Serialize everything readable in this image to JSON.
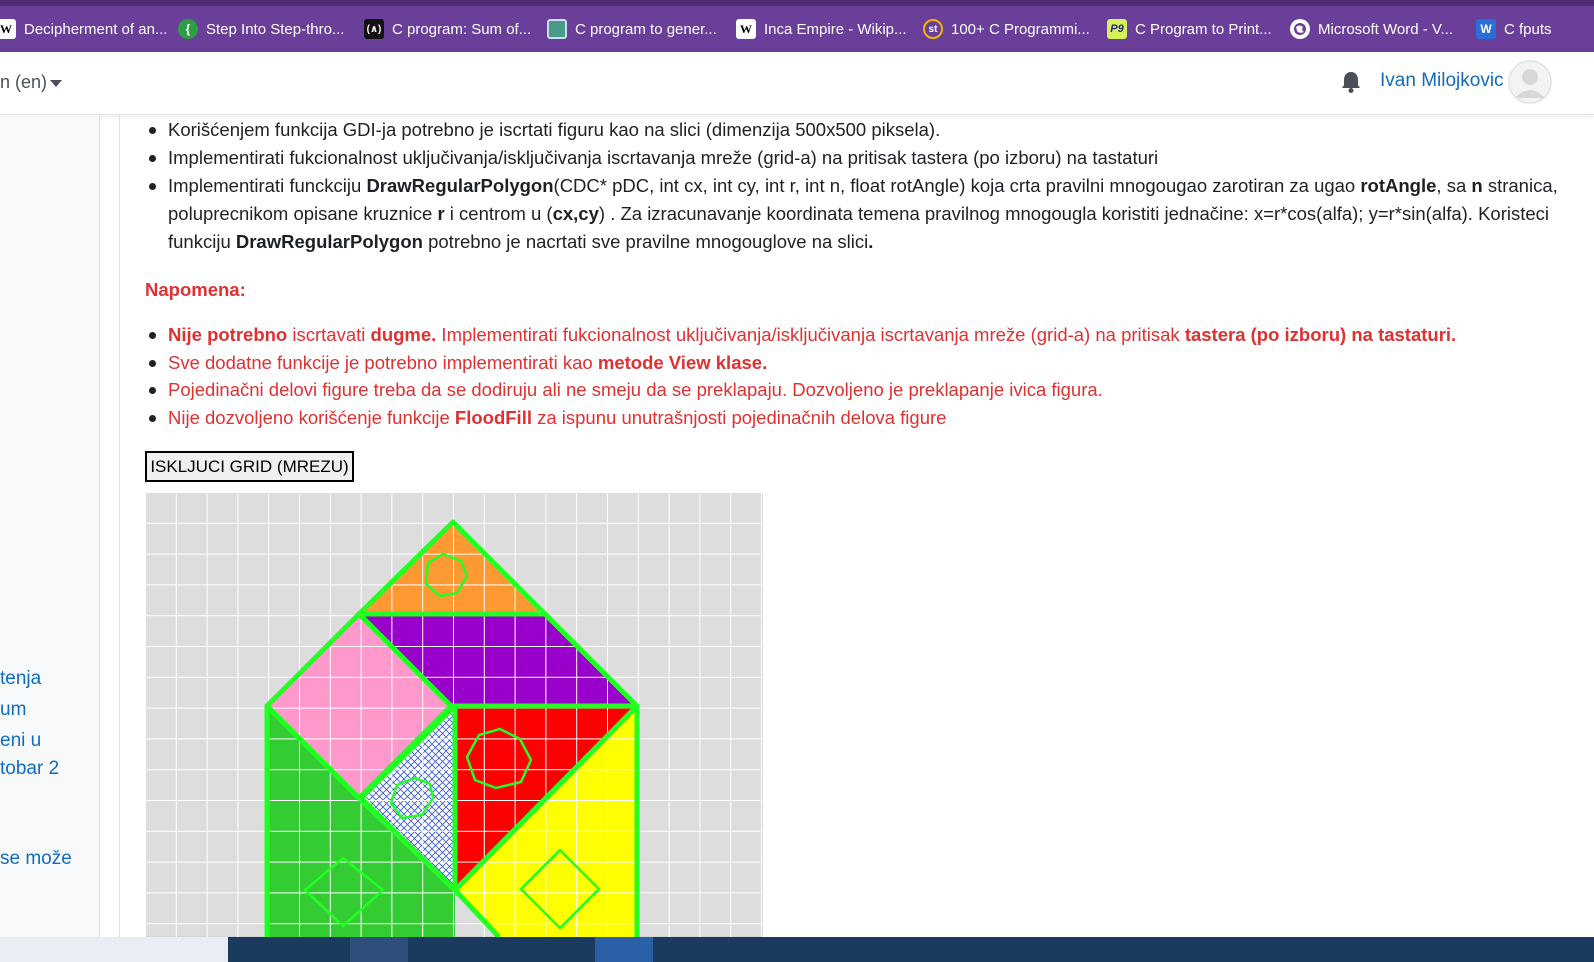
{
  "bookmarks": [
    {
      "label": "Decipherment of an...",
      "icon": "w-icon"
    },
    {
      "label": "Step Into Step-thro...",
      "icon": "green-brace-icon"
    },
    {
      "label": "C program: Sum of...",
      "icon": "code-icon"
    },
    {
      "label": "C program to gener...",
      "icon": "page-icon"
    },
    {
      "label": "Inca Empire - Wikip...",
      "icon": "wikipedia-icon"
    },
    {
      "label": "100+ C Programmi...",
      "icon": "st-icon"
    },
    {
      "label": "C Program to Print...",
      "icon": "p9-icon"
    },
    {
      "label": "Microsoft Word - V...",
      "icon": "globe-icon"
    },
    {
      "label": "C fputs",
      "icon": "w-blue-icon"
    }
  ],
  "header": {
    "language": "n (en)",
    "username": "Ivan Milojkovic"
  },
  "drawer": {
    "links": [
      "tenja",
      "um",
      "eni u",
      "tobar 2",
      "se može"
    ]
  },
  "tasks": {
    "item1": "Korišćenjem funkcija GDI-ja potrebno je iscrtati figuru kao na slici (dimenzija 500x500 piksela).",
    "item2": "Implementirati fukcionalnost uključivanja/isključivanja iscrtavanja mreže (grid-a) na pritisak tastera (po izboru) na tastaturi",
    "item3": {
      "p1": "Implementirati funckciju ",
      "b1": "DrawRegularPolygon",
      "p2": "(CDC* pDC, int cx, int cy, int r, int n, float rotAngle) koja crta pravilni mnogougao zarotiran za ugao ",
      "b2": "rotAngle",
      "p3": ", sa ",
      "b3": "n",
      "p4": " stranica, poluprecnikom opisane kruznice ",
      "b4": "r",
      "p5": " i centrom u (",
      "b5": "cx,cy",
      "p6": ") . Za izracunavanje koordinata temena pravilnog mnogougla koristiti jednačine: x=r*cos(alfa); y=r*sin(alfa). Koristeci funkciju ",
      "b6": "DrawRegularPolygon",
      "p7": " potrebno je nacrtati sve pravilne mnogouglove na slici",
      "b7": "."
    }
  },
  "notes": {
    "heading": "Napomena:",
    "n1": {
      "b1": "Nije potrebno",
      "p1": " iscrtavati ",
      "b2": "dugme.",
      "p2": " Implementirati fukcionalnost uključivanja/isključivanja iscrtavanja mreže (grid-a) na pritisak ",
      "b3": "tastera (po izboru) na tastaturi."
    },
    "n2": {
      "p1": "Sve dodatne funkcije je potrebno implementirati kao ",
      "b1": "metode View klase."
    },
    "n3": "Pojedinačni delovi figure treba da se dodiruju ali ne smeju da se preklapaju. Dozvoljeno je preklapanje ivica figura.",
    "n4": {
      "p1": "Nije dozvoljeno korišćenje funkcije ",
      "b1": "FloodFill",
      "p2": " za ispunu unutrašnjosti pojedinačnih delova figure"
    }
  },
  "grid_button_label": "ISKLJUCI GRID (MREZU)",
  "colors": {
    "bookmark_bar": "#6a3f9a",
    "link": "#0f6cbf",
    "note_red": "#e03131",
    "shape_outline": "#22ff22",
    "orange": "#ff9933",
    "purple": "#9900cc",
    "pink": "#ff99cc",
    "red": "#ff0000",
    "yellow": "#ffff00",
    "green": "#33cc33",
    "grid_background": "#dddddd",
    "grid_lines": "#ffffff"
  }
}
